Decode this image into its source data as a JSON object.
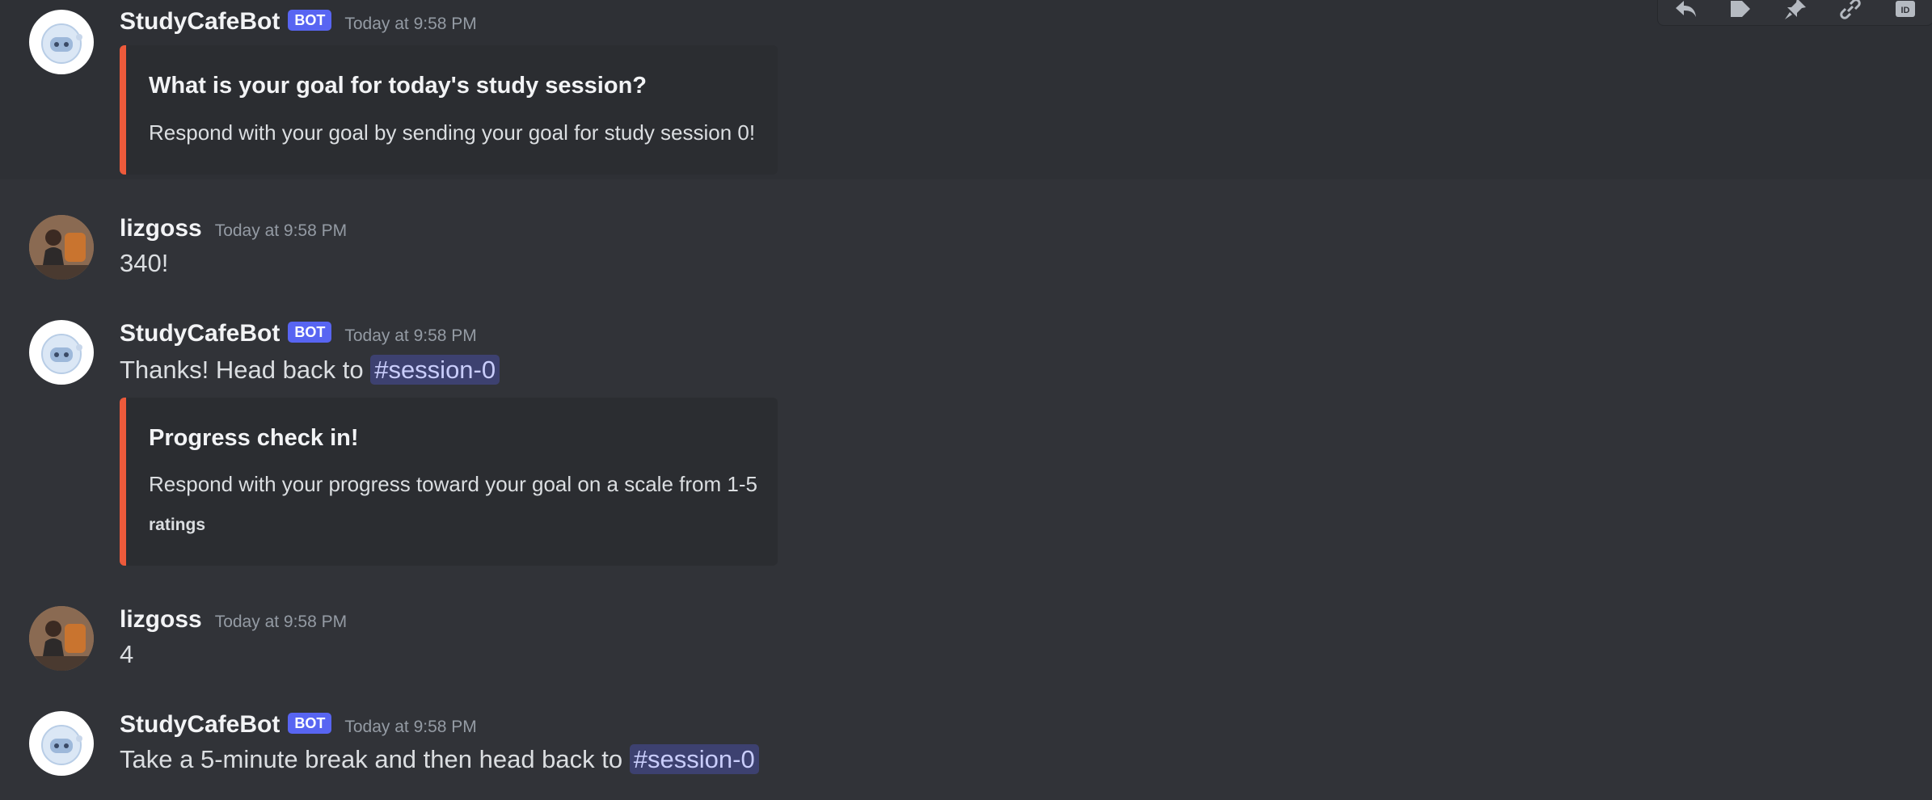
{
  "toolbar": {
    "icons": [
      "reply-icon",
      "tag-icon",
      "pin-icon",
      "link-icon",
      "id-icon"
    ]
  },
  "messages": [
    {
      "author": "StudyCafeBot",
      "is_bot": true,
      "bot_tag": "BOT",
      "time": "Today at 9:58 PM",
      "embed": {
        "title": "What is your goal for today's study session?",
        "description": "Respond with your goal by sending your goal for study session 0!",
        "accent": "#ed5a3b"
      }
    },
    {
      "author": "lizgoss",
      "time": "Today at 9:58 PM",
      "text": "340!"
    },
    {
      "author": "StudyCafeBot",
      "is_bot": true,
      "bot_tag": "BOT",
      "time": "Today at 9:58 PM",
      "text": "Thanks! Head back to",
      "mention": "session-0",
      "embed": {
        "title": "Progress check in!",
        "description": "Respond with your progress toward your goal on a scale from 1-5",
        "footer": "ratings",
        "accent": "#ed5a3b"
      }
    },
    {
      "author": "lizgoss",
      "time": "Today at 9:58 PM",
      "text": "4"
    },
    {
      "author": "StudyCafeBot",
      "is_bot": true,
      "bot_tag": "BOT",
      "time": "Today at 9:58 PM",
      "text": "Take a 5-minute break and then head back to",
      "mention": "session-0"
    }
  ],
  "colors": {
    "background": "#313338",
    "bot_tag": "#5865f2",
    "mention_bg": "#3c4270",
    "embed_accent": "#ed5a3b"
  }
}
